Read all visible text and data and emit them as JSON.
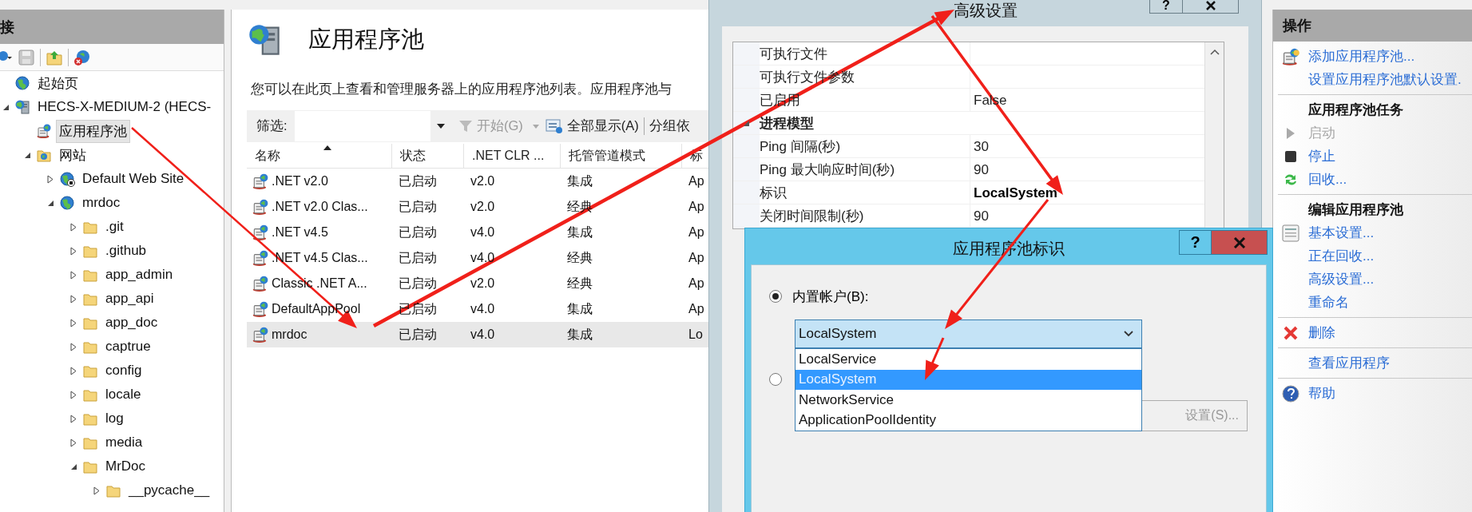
{
  "connections": {
    "header": "接",
    "tree": [
      {
        "kind": "start-page",
        "label": "起始页",
        "selected": false
      },
      {
        "kind": "server",
        "label": "HECS-X-MEDIUM-2 (HECS-",
        "expanded": true,
        "selected": false,
        "children": [
          {
            "kind": "app-pools",
            "label": "应用程序池",
            "selected": true
          },
          {
            "kind": "sites",
            "label": "网站",
            "expanded": true,
            "selected": false,
            "children": [
              {
                "kind": "site",
                "label": "Default Web Site",
                "expanded": false,
                "running": false,
                "selected": false
              },
              {
                "kind": "site",
                "label": "mrdoc",
                "expanded": true,
                "running": true,
                "selected": false,
                "children": [
                  {
                    "kind": "folder",
                    "label": ".git",
                    "expanded": false,
                    "selected": false
                  },
                  {
                    "kind": "folder",
                    "label": ".github",
                    "expanded": false,
                    "selected": false
                  },
                  {
                    "kind": "folder",
                    "label": "app_admin",
                    "expanded": false,
                    "selected": false
                  },
                  {
                    "kind": "folder",
                    "label": "app_api",
                    "expanded": false,
                    "selected": false
                  },
                  {
                    "kind": "folder",
                    "label": "app_doc",
                    "expanded": false,
                    "selected": false
                  },
                  {
                    "kind": "folder",
                    "label": "captrue",
                    "expanded": false,
                    "selected": false
                  },
                  {
                    "kind": "folder",
                    "label": "config",
                    "expanded": false,
                    "selected": false
                  },
                  {
                    "kind": "folder",
                    "label": "locale",
                    "expanded": false,
                    "selected": false
                  },
                  {
                    "kind": "folder",
                    "label": "log",
                    "expanded": false,
                    "selected": false
                  },
                  {
                    "kind": "folder",
                    "label": "media",
                    "expanded": false,
                    "selected": false
                  },
                  {
                    "kind": "folder",
                    "label": "MrDoc",
                    "expanded": true,
                    "selected": false,
                    "children": [
                      {
                        "kind": "folder",
                        "label": "__pycache__",
                        "expanded": false,
                        "selected": false
                      }
                    ]
                  }
                ]
              }
            ]
          }
        ]
      }
    ]
  },
  "pools": {
    "title": "应用程序池",
    "description": "您可以在此页上查看和管理服务器上的应用程序池列表。应用程序池与",
    "toolbar": {
      "filter_label": "筛选:",
      "start": {
        "label": "开始(G)",
        "disabled": true
      },
      "show_all": "全部显示(A)",
      "group_by": "分组依"
    },
    "columns": [
      {
        "label": "名称",
        "sorted": true
      },
      {
        "label": "状态",
        "sorted": false
      },
      {
        "label": ".NET CLR ...",
        "sorted": false
      },
      {
        "label": "托管管道模式",
        "sorted": false
      },
      {
        "label": "标",
        "sorted": false
      }
    ],
    "rows": [
      {
        "name": ".NET v2.0",
        "status": "已启动",
        "clr": "v2.0",
        "pipeline": "集成",
        "identity": "Ap",
        "selected": false
      },
      {
        "name": ".NET v2.0 Clas...",
        "status": "已启动",
        "clr": "v2.0",
        "pipeline": "经典",
        "identity": "Ap",
        "selected": false
      },
      {
        "name": ".NET v4.5",
        "status": "已启动",
        "clr": "v4.0",
        "pipeline": "集成",
        "identity": "Ap",
        "selected": false
      },
      {
        "name": ".NET v4.5 Clas...",
        "status": "已启动",
        "clr": "v4.0",
        "pipeline": "经典",
        "identity": "Ap",
        "selected": false
      },
      {
        "name": "Classic .NET A...",
        "status": "已启动",
        "clr": "v2.0",
        "pipeline": "经典",
        "identity": "Ap",
        "selected": false
      },
      {
        "name": "DefaultAppPool",
        "status": "已启动",
        "clr": "v4.0",
        "pipeline": "集成",
        "identity": "Ap",
        "selected": false
      },
      {
        "name": "mrdoc",
        "status": "已启动",
        "clr": "v4.0",
        "pipeline": "集成",
        "identity": "Lo",
        "selected": true
      }
    ]
  },
  "advanced_settings": {
    "title": "高级设置",
    "help": "?",
    "rows": [
      {
        "kind": "property",
        "name": "可执行文件"
      },
      {
        "kind": "property",
        "name": "可执行文件参数"
      },
      {
        "kind": "property",
        "name": "已启用",
        "value": "False",
        "modified": false
      },
      {
        "kind": "category",
        "name": "进程模型",
        "expanded": true
      },
      {
        "kind": "property",
        "name": "Ping 间隔(秒)",
        "value": "30",
        "modified": false
      },
      {
        "kind": "property",
        "name": "Ping 最大响应时间(秒)",
        "value": "90",
        "modified": false
      },
      {
        "kind": "property",
        "name": "标识",
        "value": "LocalSystem",
        "modified": true
      },
      {
        "kind": "property",
        "name": "关闭时间限制(秒)",
        "value": "90",
        "modified": false
      }
    ]
  },
  "identity_dialog": {
    "title": "应用程序池标识",
    "help": "?",
    "radios": [
      {
        "label": "内置帐户(B):",
        "selected": true
      },
      {
        "selected": false
      }
    ],
    "account": {
      "value": "LocalSystem",
      "expanded": true,
      "options": [
        {
          "label": "LocalService",
          "selected": false
        },
        {
          "label": "LocalSystem",
          "selected": true
        },
        {
          "label": "NetworkService",
          "selected": false
        },
        {
          "label": "ApplicationPoolIdentity",
          "selected": false
        }
      ]
    },
    "settings_button": {
      "label": "设置(S)...",
      "disabled": true
    }
  },
  "actions": {
    "header": "操作",
    "sections": [
      {
        "items": [
          {
            "kind": "link",
            "label": "添加应用程序池...",
            "disabled": false
          },
          {
            "kind": "link",
            "label": "设置应用程序池默认设置.",
            "disabled": false
          }
        ]
      },
      {
        "items": [
          {
            "kind": "heading",
            "label": "应用程序池任务"
          },
          {
            "kind": "link",
            "label": "启动",
            "disabled": true
          },
          {
            "kind": "link",
            "label": "停止",
            "disabled": false
          },
          {
            "kind": "link",
            "label": "回收...",
            "disabled": false
          }
        ]
      },
      {
        "items": [
          {
            "kind": "heading",
            "label": "编辑应用程序池"
          },
          {
            "kind": "link",
            "label": "基本设置...",
            "disabled": false
          },
          {
            "kind": "link",
            "label": "正在回收...",
            "disabled": false
          },
          {
            "kind": "link",
            "label": "高级设置...",
            "disabled": false
          },
          {
            "kind": "link",
            "label": "重命名",
            "disabled": false
          }
        ]
      },
      {
        "items": [
          {
            "kind": "link",
            "label": "删除",
            "disabled": false
          }
        ]
      },
      {
        "items": [
          {
            "kind": "link",
            "label": "查看应用程序",
            "disabled": false
          }
        ]
      },
      {
        "items": [
          {
            "kind": "link",
            "label": "帮助",
            "disabled": false
          }
        ]
      }
    ]
  }
}
